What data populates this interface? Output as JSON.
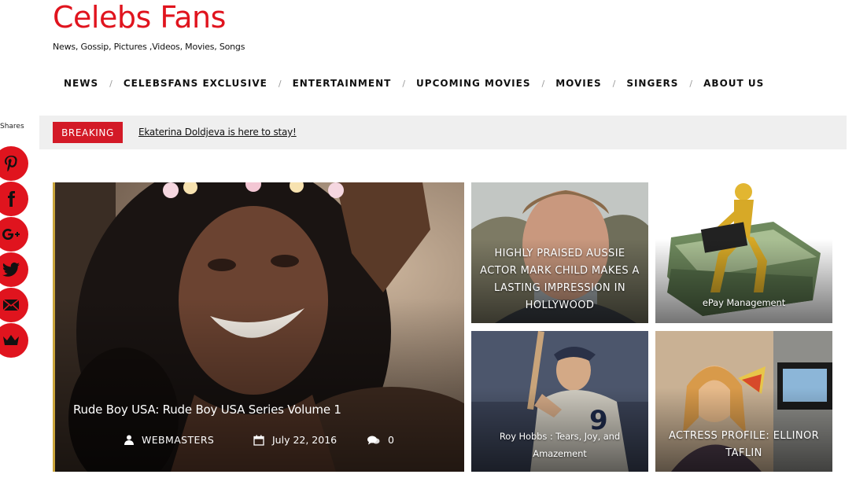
{
  "site": {
    "title": "Celebs Fans",
    "tagline": "News, Gossip, Pictures ,Videos, Movies, Songs"
  },
  "nav": {
    "items": [
      "NEWS",
      "CELEBSFANS EXCLUSIVE",
      "ENTERTAINMENT",
      "UPCOMING MOVIES",
      "MOVIES",
      "SINGERS",
      "ABOUT US"
    ],
    "separator": "/"
  },
  "share": {
    "label": "Shares",
    "icons": [
      "pinterest-icon",
      "facebook-icon",
      "google-plus-icon",
      "twitter-icon",
      "email-icon",
      "crown-icon"
    ],
    "color": "#e0141e"
  },
  "breaking": {
    "label": "BREAKING",
    "headline": "Ekaterina Doldjeva is here to stay!",
    "label_color": "#d31a27"
  },
  "feature": {
    "title": "Rude Boy USA: Rude Boy USA Series Volume 1",
    "author": "WEBMASTERS",
    "date": "July 22, 2016",
    "comments": "0"
  },
  "cards": [
    {
      "title": "HIGHLY PRAISED AUSSIE ACTOR MARK CHILD MAKES A LASTING IMPRESSION IN HOLLYWOOD"
    },
    {
      "title": "ePay Management"
    },
    {
      "title": "Roy Hobbs : Tears, Joy, and Amazement"
    },
    {
      "title": "ACTRESS PROFILE: ELLINOR TAFLIN"
    }
  ]
}
